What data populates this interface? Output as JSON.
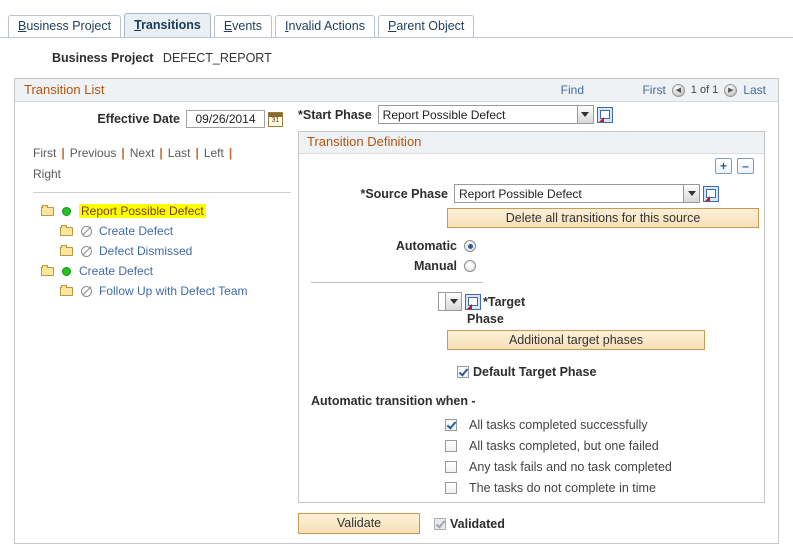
{
  "tabs": [
    {
      "label": "Business Project",
      "accesskey": "B",
      "active": false
    },
    {
      "label": "Transitions",
      "accesskey": "T",
      "active": true
    },
    {
      "label": "Events",
      "accesskey": "E",
      "active": false
    },
    {
      "label": "Invalid Actions",
      "accesskey": "I",
      "active": false
    },
    {
      "label": "Parent Object",
      "accesskey": "P",
      "active": false
    }
  ],
  "business_project": {
    "label": "Business Project",
    "value": "DEFECT_REPORT"
  },
  "transition_list": {
    "title": "Transition List",
    "find_label": "Find",
    "first_label": "First",
    "last_label": "Last",
    "page_count": "1 of 1",
    "effective_date": {
      "label": "Effective Date",
      "value": "09/26/2014"
    },
    "nav_links": [
      "First",
      "Previous",
      "Next",
      "Last",
      "Left",
      "Right"
    ],
    "tree": [
      {
        "label": "Report Possible Defect",
        "level": 1,
        "status": "active",
        "selected": true
      },
      {
        "label": "Create Defect",
        "level": 2,
        "status": "none",
        "selected": false
      },
      {
        "label": "Defect Dismissed",
        "level": 2,
        "status": "none",
        "selected": false
      },
      {
        "label": "Create Defect",
        "level": 1,
        "status": "active",
        "selected": false
      },
      {
        "label": "Follow Up with Defect Team",
        "level": 2,
        "status": "none",
        "selected": false
      }
    ]
  },
  "start_phase": {
    "label": "*Start Phase",
    "value": "Report Possible Defect"
  },
  "transition_definition": {
    "title": "Transition Definition",
    "add_label": "+",
    "remove_label": "–",
    "source_phase": {
      "label": "*Source Phase",
      "value": "Report Possible Defect"
    },
    "delete_all_label": "Delete all transitions for this source",
    "mode": {
      "automatic_label": "Automatic",
      "manual_label": "Manual",
      "selected": "automatic"
    },
    "target": {
      "label": "*Target",
      "phase_label": "Phase",
      "value": "",
      "additional_label": "Additional target phases"
    },
    "default_target_phase": {
      "label": "Default Target Phase",
      "checked": true
    },
    "automatic_when_label": "Automatic transition when -",
    "conditions": [
      {
        "label": "All tasks completed successfully",
        "checked": true
      },
      {
        "label": "All tasks completed, but one failed",
        "checked": false
      },
      {
        "label": "Any task fails and no task completed",
        "checked": false
      },
      {
        "label": "The tasks do not complete in time",
        "checked": false
      }
    ]
  },
  "footer": {
    "validate_label": "Validate",
    "validated_label": "Validated",
    "validated_checked": true
  }
}
